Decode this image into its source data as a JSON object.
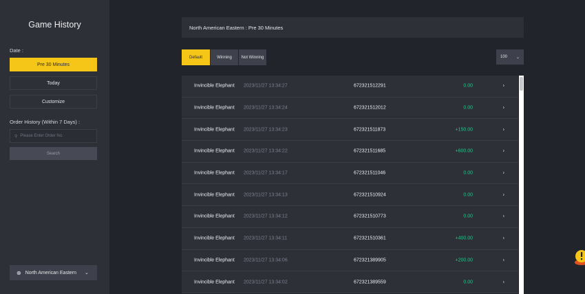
{
  "sidebar": {
    "title": "Game History",
    "date_label": "Date :",
    "date_buttons": [
      "Pre 30 Minutes",
      "Today",
      "Customize"
    ],
    "order_label": "Order History (Within 7 Days) :",
    "order_placeholder": "Please Enter Order No.",
    "search_label": "Search",
    "region": "North American Eastern"
  },
  "header": {
    "title": "North American Eastern : Pre 30 Minutes"
  },
  "filters": [
    "Default",
    "Winning",
    "Not Winning"
  ],
  "page_size": "100",
  "colors": {
    "accent": "#f5c518",
    "win_amount": "#2fbf8a"
  },
  "rows": [
    {
      "game": "Invincible Elephant",
      "time": "2023/11/27 13:34:27",
      "order": "672321512291",
      "amount": "0.00"
    },
    {
      "game": "Invincible Elephant",
      "time": "2023/11/27 13:34:24",
      "order": "672321512012",
      "amount": "0.00"
    },
    {
      "game": "Invincible Elephant",
      "time": "2023/11/27 13:34:23",
      "order": "672321511873",
      "amount": "+150.00"
    },
    {
      "game": "Invincible Elephant",
      "time": "2023/11/27 13:34:22",
      "order": "672321511685",
      "amount": "+600.00"
    },
    {
      "game": "Invincible Elephant",
      "time": "2023/11/27 13:34:17",
      "order": "672321511046",
      "amount": "0.00"
    },
    {
      "game": "Invincible Elephant",
      "time": "2023/11/27 13:34:13",
      "order": "672321510924",
      "amount": "0.00"
    },
    {
      "game": "Invincible Elephant",
      "time": "2023/11/27 13:34:12",
      "order": "672321510773",
      "amount": "0.00"
    },
    {
      "game": "Invincible Elephant",
      "time": "2023/11/27 13:34:11",
      "order": "672321510361",
      "amount": "+400.00"
    },
    {
      "game": "Invincible Elephant",
      "time": "2023/11/27 13:34:06",
      "order": "672321389905",
      "amount": "+200.00"
    },
    {
      "game": "Invincible Elephant",
      "time": "2023/11/27 13:34:02",
      "order": "672321389559",
      "amount": "0.00"
    }
  ]
}
